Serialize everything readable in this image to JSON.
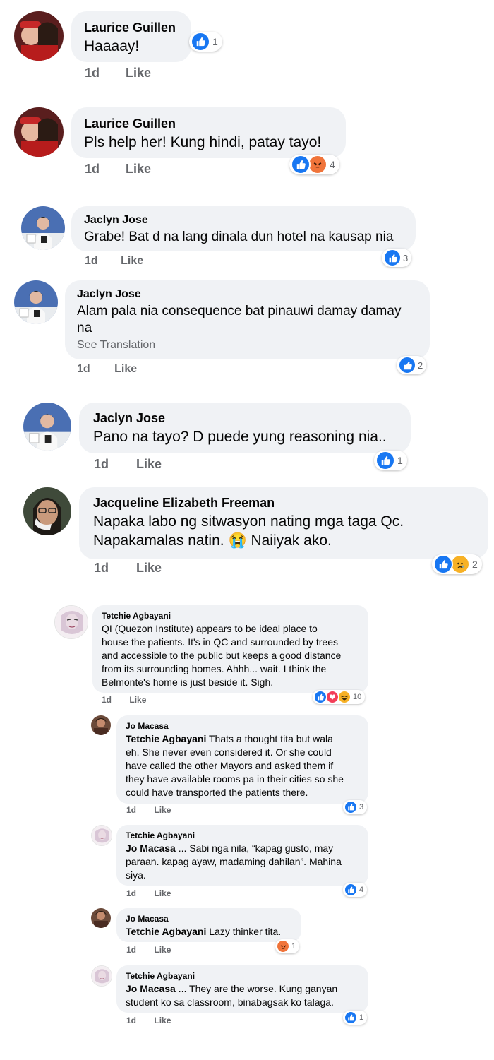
{
  "comments": [
    {
      "author": "Laurice Guillen",
      "text": "Haaaay!",
      "time": "1d",
      "like": "Like",
      "reactions": [
        "like"
      ],
      "count": "1"
    },
    {
      "author": "Laurice Guillen",
      "text": "Pls help her! Kung hindi, patay tayo!",
      "time": "1d",
      "like": "Like",
      "reactions": [
        "like",
        "angry"
      ],
      "count": "4"
    },
    {
      "author": "Jaclyn Jose",
      "text": "Grabe! Bat d na lang dinala dun hotel na kausap nia",
      "time": "1d",
      "like": "Like",
      "reactions": [
        "like"
      ],
      "count": "3"
    },
    {
      "author": "Jaclyn Jose",
      "text_line1": "Alam pala nia consequence bat pinauwi damay damay",
      "text_line2": "na",
      "translate": "See Translation",
      "time": "1d",
      "like": "Like",
      "reactions": [
        "like"
      ],
      "count": "2"
    },
    {
      "author": "Jaclyn Jose",
      "text": "Pano na tayo? D puede yung reasoning nia..",
      "time": "1d",
      "like": "Like",
      "reactions": [
        "like"
      ],
      "count": "1"
    },
    {
      "author": "Jacqueline Elizabeth Freeman",
      "text_line1": "Napaka labo ng sitwasyon nating mga taga Qc.",
      "text_line2_a": "Napakamalas natin.",
      "emoji": "😭",
      "text_line2_b": "Naiiyak ako.",
      "time": "1d",
      "like": "Like",
      "reactions": [
        "like",
        "sad"
      ],
      "count": "2"
    },
    {
      "author": "Tetchie Agbayani",
      "lines": [
        "QI (Quezon Institute) appears to be ideal place to",
        "house the patients. It's in QC and surrounded by trees",
        "and accessible to the public but keeps a good distance",
        "from its surrounding homes. Ahhh... wait. I think the",
        "Belmonte's home is just beside it. Sigh."
      ],
      "time": "1d",
      "like": "Like",
      "reactions": [
        "like",
        "heart",
        "haha"
      ],
      "count": "10"
    }
  ],
  "replies": [
    {
      "author": "Jo Macasa",
      "mention": "Tetchie Agbayani",
      "lines": [
        " Thats a thought tita but wala",
        "eh. She never even considered it. Or she could",
        "have called the other Mayors and asked them if",
        "they have available rooms pa in their cities so she",
        "could have transported the patients there."
      ],
      "time": "1d",
      "like": "Like",
      "reactions": [
        "like"
      ],
      "count": "3"
    },
    {
      "author": "Tetchie Agbayani",
      "mention": "Jo Macasa",
      "lines": [
        " ... Sabi nga nila, “kapag gusto, may",
        "paraan. kapag ayaw, madaming dahilan”. Mahina",
        "siya."
      ],
      "time": "1d",
      "like": "Like",
      "reactions": [
        "like"
      ],
      "count": "4"
    },
    {
      "author": "Jo Macasa",
      "mention": "Tetchie Agbayani",
      "lines": [
        " Lazy thinker tita."
      ],
      "time": "1d",
      "like": "Like",
      "reactions": [
        "angry"
      ],
      "count": "1"
    },
    {
      "author": "Tetchie Agbayani",
      "mention": "Jo Macasa",
      "lines": [
        " ... They are the worse. Kung ganyan",
        "student ko sa classroom, binabagsak ko talaga."
      ],
      "time": "1d",
      "like": "Like",
      "reactions": [
        "like"
      ],
      "count": "1"
    }
  ],
  "colors": {
    "bubble": "#f0f2f5",
    "meta": "#65676b",
    "like_blue": "#1877f2",
    "angry_orange": "#f0743a",
    "sad_yellow": "#f7b125",
    "heart_red": "#f33e58"
  },
  "icons": {
    "like": "thumbs-up-icon",
    "angry": "angry-face-icon",
    "sad": "sad-face-icon",
    "heart": "heart-icon",
    "haha": "haha-face-icon"
  }
}
